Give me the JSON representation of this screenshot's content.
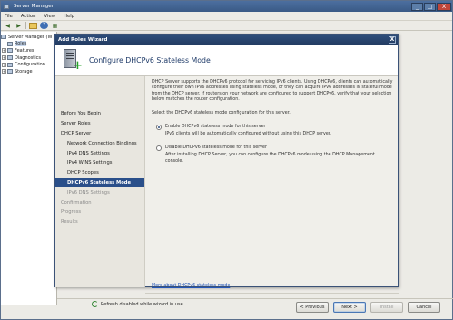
{
  "server_manager": {
    "title": "Server Manager",
    "window_buttons": [
      "_",
      "□",
      "X"
    ],
    "menu": [
      "File",
      "Action",
      "View",
      "Help"
    ],
    "tree": [
      {
        "label": "Server Manager (W",
        "expander": "",
        "selected": false
      },
      {
        "label": "Roles",
        "expander": "",
        "selected": true
      },
      {
        "label": "Features",
        "expander": "+",
        "selected": false
      },
      {
        "label": "Diagnostics",
        "expander": "+",
        "selected": false
      },
      {
        "label": "Configuration",
        "expander": "+",
        "selected": false
      },
      {
        "label": "Storage",
        "expander": "+",
        "selected": false
      }
    ],
    "status": "Refresh disabled while wizard in use"
  },
  "wizard": {
    "title": "Add Roles Wizard",
    "close": "X",
    "header_title": "Configure DHCPv6 Stateless Mode",
    "nav": [
      {
        "label": "Before You Begin",
        "state": "done",
        "sub": false
      },
      {
        "label": "Server Roles",
        "state": "done",
        "sub": false
      },
      {
        "label": "DHCP Server",
        "state": "done",
        "sub": false
      },
      {
        "label": "Network Connection Bindings",
        "state": "done",
        "sub": true
      },
      {
        "label": "IPv4 DNS Settings",
        "state": "done",
        "sub": true
      },
      {
        "label": "IPv4 WINS Settings",
        "state": "done",
        "sub": true
      },
      {
        "label": "DHCP Scopes",
        "state": "done",
        "sub": true
      },
      {
        "label": "DHCPv6 Stateless Mode",
        "state": "current",
        "sub": true
      },
      {
        "label": "IPv6 DNS Settings",
        "state": "future",
        "sub": true
      },
      {
        "label": "Confirmation",
        "state": "future",
        "sub": false
      },
      {
        "label": "Progress",
        "state": "future",
        "sub": false
      },
      {
        "label": "Results",
        "state": "future",
        "sub": false
      }
    ],
    "description": "DHCP Server supports the DHCPv6 protocol for servicing IPv6 clients. Using DHCPv6, clients can automatically configure their own IPv6 addresses using stateless mode, or they can acquire IPv6 addresses in stateful mode from the DHCP server. If routers on your network are configured to support DHCPv6, verify that your selection below matches the router configuration.",
    "prompt": "Select the DHCPv6 stateless mode configuration for this server.",
    "options": [
      {
        "label": "Enable DHCPv6 stateless mode for this server",
        "note": "IPv6 clients will be automatically configured without using this DHCP server.",
        "checked": true
      },
      {
        "label": "Disable DHCPv6 stateless mode for this server",
        "note": "After installing DHCP Server, you can configure the DHCPv6 mode using the DHCP Management console.",
        "checked": false
      }
    ],
    "more_link": "More about DHCPv6 stateless mode",
    "buttons": {
      "previous": "< Previous",
      "next": "Next >",
      "install": "Install",
      "cancel": "Cancel"
    }
  }
}
